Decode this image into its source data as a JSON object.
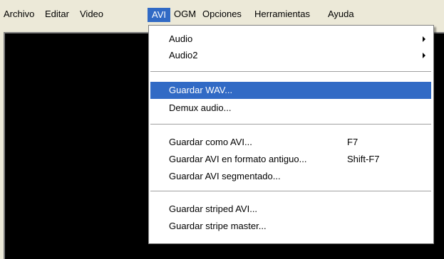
{
  "menubar": {
    "items": [
      {
        "label": "Archivo"
      },
      {
        "label": "Editar"
      },
      {
        "label": "Video"
      },
      {
        "label": "AVI"
      },
      {
        "label": "OGM"
      },
      {
        "label": "Opciones"
      },
      {
        "label": "Herramientas"
      },
      {
        "label": "Ayuda"
      }
    ],
    "active": "AVI"
  },
  "dropdown": {
    "items": [
      {
        "label": "Audio",
        "submenu": true,
        "icon": "chevron-right-icon"
      },
      {
        "label": "Audio2",
        "submenu": true,
        "icon": "chevron-right-icon"
      },
      {
        "label": "Guardar WAV...",
        "highlighted": true
      },
      {
        "label": "Demux audio..."
      },
      {
        "label": "Guardar como AVI...",
        "shortcut": "F7"
      },
      {
        "label": "Guardar AVI en formato antiguo...",
        "shortcut": "Shift-F7"
      },
      {
        "label": "Guardar AVI segmentado..."
      },
      {
        "label": "Guardar striped AVI..."
      },
      {
        "label": "Guardar stripe master..."
      }
    ]
  },
  "colors": {
    "highlight": "#316ac5",
    "menu_background": "#ece9d8",
    "video_background": "#000000"
  }
}
